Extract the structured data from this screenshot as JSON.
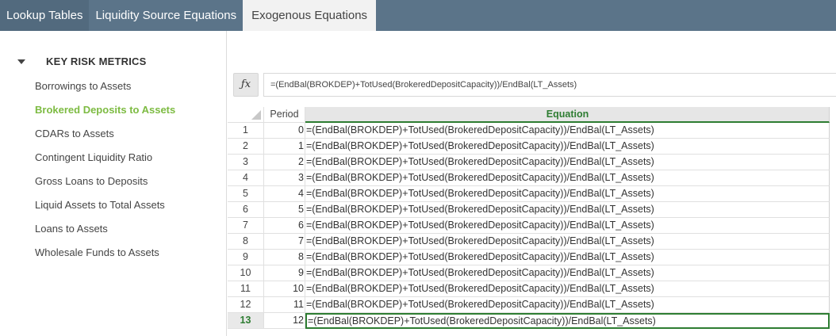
{
  "tabs": [
    {
      "label": "Lookup Tables",
      "state": "dark"
    },
    {
      "label": "Liquidity Source Equations",
      "state": "mid"
    },
    {
      "label": "Exogenous Equations",
      "state": "active"
    }
  ],
  "sidebar": {
    "group_title": "KEY RISK METRICS",
    "items": [
      {
        "label": "Borrowings to Assets"
      },
      {
        "label": "Brokered Deposits to Assets",
        "active": true
      },
      {
        "label": "CDARs to Assets"
      },
      {
        "label": "Contingent Liquidity Ratio"
      },
      {
        "label": "Gross Loans to Deposits"
      },
      {
        "label": "Liquid Assets to Total Assets"
      },
      {
        "label": "Loans to Assets"
      },
      {
        "label": "Wholesale Funds to Assets"
      }
    ]
  },
  "formula_bar": {
    "fx_label": "ƒx",
    "value": "=(EndBal(BROKDEP)+TotUsed(BrokeredDepositCapacity))/EndBal(LT_Assets)"
  },
  "grid": {
    "headers": {
      "period": "Period",
      "equation": "Equation"
    },
    "selected_row": 13,
    "rows": [
      {
        "num": "1",
        "period": "0",
        "equation": "=(EndBal(BROKDEP)+TotUsed(BrokeredDepositCapacity))/EndBal(LT_Assets)"
      },
      {
        "num": "2",
        "period": "1",
        "equation": "=(EndBal(BROKDEP)+TotUsed(BrokeredDepositCapacity))/EndBal(LT_Assets)"
      },
      {
        "num": "3",
        "period": "2",
        "equation": "=(EndBal(BROKDEP)+TotUsed(BrokeredDepositCapacity))/EndBal(LT_Assets)"
      },
      {
        "num": "4",
        "period": "3",
        "equation": "=(EndBal(BROKDEP)+TotUsed(BrokeredDepositCapacity))/EndBal(LT_Assets)"
      },
      {
        "num": "5",
        "period": "4",
        "equation": "=(EndBal(BROKDEP)+TotUsed(BrokeredDepositCapacity))/EndBal(LT_Assets)"
      },
      {
        "num": "6",
        "period": "5",
        "equation": "=(EndBal(BROKDEP)+TotUsed(BrokeredDepositCapacity))/EndBal(LT_Assets)"
      },
      {
        "num": "7",
        "period": "6",
        "equation": "=(EndBal(BROKDEP)+TotUsed(BrokeredDepositCapacity))/EndBal(LT_Assets)"
      },
      {
        "num": "8",
        "period": "7",
        "equation": "=(EndBal(BROKDEP)+TotUsed(BrokeredDepositCapacity))/EndBal(LT_Assets)"
      },
      {
        "num": "9",
        "period": "8",
        "equation": "=(EndBal(BROKDEP)+TotUsed(BrokeredDepositCapacity))/EndBal(LT_Assets)"
      },
      {
        "num": "10",
        "period": "9",
        "equation": "=(EndBal(BROKDEP)+TotUsed(BrokeredDepositCapacity))/EndBal(LT_Assets)"
      },
      {
        "num": "11",
        "period": "10",
        "equation": "=(EndBal(BROKDEP)+TotUsed(BrokeredDepositCapacity))/EndBal(LT_Assets)"
      },
      {
        "num": "12",
        "period": "11",
        "equation": "=(EndBal(BROKDEP)+TotUsed(BrokeredDepositCapacity))/EndBal(LT_Assets)"
      },
      {
        "num": "13",
        "period": "12",
        "equation": "=(EndBal(BROKDEP)+TotUsed(BrokeredDepositCapacity))/EndBal(LT_Assets)"
      }
    ]
  },
  "colors": {
    "tabbar": "#5b7489",
    "active_item": "#7dbb42",
    "grid_accent": "#2e7d32"
  }
}
